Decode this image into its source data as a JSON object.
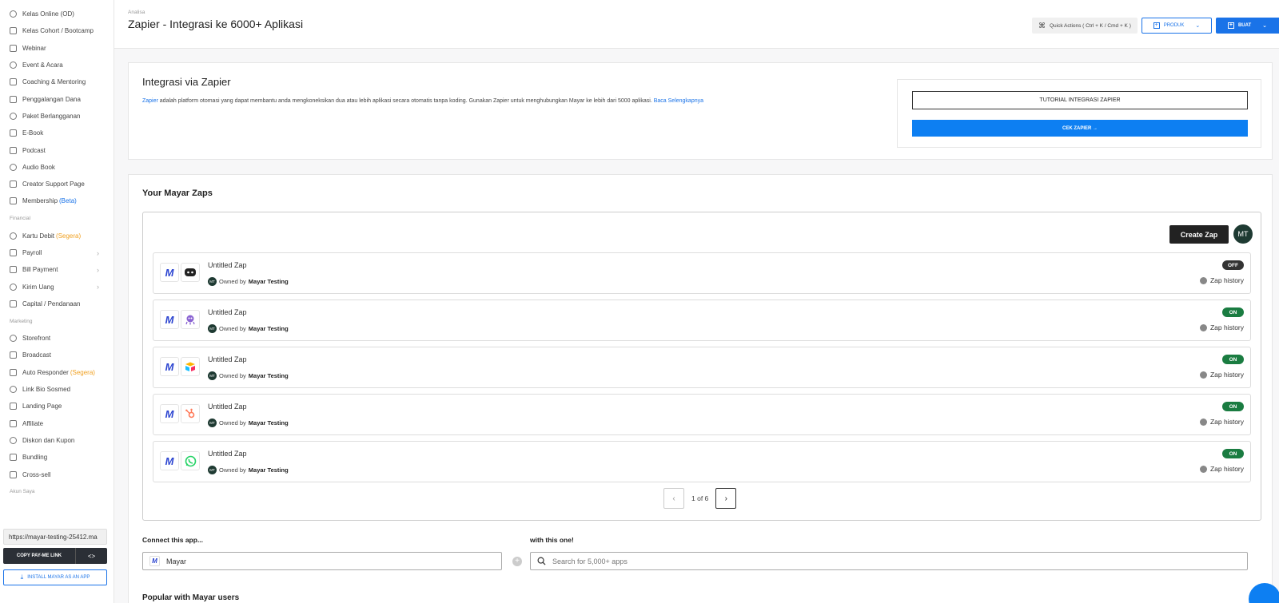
{
  "sidebar": {
    "items_top": [
      {
        "label": "Kelas Online (OD)",
        "icon": "grid-icon"
      },
      {
        "label": "Kelas Cohort / Bootcamp",
        "icon": "grid-icon"
      },
      {
        "label": "Webinar",
        "icon": "video-icon"
      },
      {
        "label": "Event & Acara",
        "icon": "event-icon"
      },
      {
        "label": "Coaching & Mentoring",
        "icon": "coach-icon"
      },
      {
        "label": "Penggalangan Dana",
        "icon": "heart-icon"
      },
      {
        "label": "Paket Berlangganan",
        "icon": "calendar-icon"
      },
      {
        "label": "E-Book",
        "icon": "book-icon"
      },
      {
        "label": "Podcast",
        "icon": "mic-icon"
      },
      {
        "label": "Audio Book",
        "icon": "headphones-icon"
      },
      {
        "label": "Creator Support Page",
        "icon": "smile-icon"
      },
      {
        "label": "Membership",
        "icon": "member-icon",
        "badge": "(Beta)"
      }
    ],
    "section_financial": "Financial",
    "items_financial": [
      {
        "label": "Kartu Debit",
        "badge": "(Segera)",
        "icon": "card-icon"
      },
      {
        "label": "Payroll",
        "icon": "payroll-icon",
        "chevron": true
      },
      {
        "label": "Bill Payment",
        "icon": "bill-icon",
        "chevron": true
      },
      {
        "label": "Kirim Uang",
        "icon": "send-icon",
        "chevron": true
      },
      {
        "label": "Capital / Pendanaan",
        "icon": "capital-icon"
      }
    ],
    "section_marketing": "Marketing",
    "items_marketing": [
      {
        "label": "Storefront",
        "icon": "store-icon"
      },
      {
        "label": "Broadcast",
        "icon": "rss-icon"
      },
      {
        "label": "Auto Responder",
        "badge": "(Segera)",
        "icon": "responder-icon"
      },
      {
        "label": "Link Bio Sosmed",
        "icon": "bookmark-icon"
      },
      {
        "label": "Landing Page",
        "icon": "monitor-icon"
      },
      {
        "label": "Affiliate",
        "icon": "affiliate-icon"
      },
      {
        "label": "Diskon dan Kupon",
        "icon": "percent-icon"
      },
      {
        "label": "Bundling",
        "icon": "box-icon"
      },
      {
        "label": "Cross-sell",
        "icon": "cross-sell-icon"
      }
    ],
    "section_account": "Akun Saya",
    "link_value": "https://mayar-testing-25412.ma",
    "copy_label": "COPY PAY-ME LINK",
    "code_label": "<>",
    "install_label": "INSTALL MAYAR AS AN APP"
  },
  "header": {
    "breadcrumb": "Analisa",
    "title": "Zapier - Integrasi ke 6000+ Aplikasi",
    "quick_actions": "Quick Actions ( Ctrl + K / Cmd + K )",
    "produk_label": "PRODUK",
    "buat_label": "BUAT"
  },
  "integration": {
    "title": "Integrasi via Zapier",
    "desc_link": "Zapier",
    "desc": " adalah platform otomasi yang dapat membantu anda mengkoneksikan dua atau lebih aplikasi secara otomatis tanpa koding. Gunakan Zapier untuk menghubungkan Mayar ke lebih dari 5000 aplikasi. ",
    "read_more": "Baca Selengkapnya",
    "tutorial_label": "TUTORIAL INTEGRASI ZAPIER",
    "cek_label": "CEK ZAPIER →"
  },
  "zaps": {
    "title": "Your Mayar Zaps",
    "create_label": "Create Zap",
    "avatar": "MT",
    "rows": [
      {
        "name": "Untitled Zap",
        "owned_prefix": "Owned by",
        "owner": "Mayar Testing",
        "status": "OFF",
        "app": "discord-icon",
        "history": "Zap history"
      },
      {
        "name": "Untitled Zap",
        "owned_prefix": "Owned by",
        "owner": "Mayar Testing",
        "status": "ON",
        "app": "octopus-icon",
        "history": "Zap history"
      },
      {
        "name": "Untitled Zap",
        "owned_prefix": "Owned by",
        "owner": "Mayar Testing",
        "status": "ON",
        "app": "airtable-icon",
        "history": "Zap history"
      },
      {
        "name": "Untitled Zap",
        "owned_prefix": "Owned by",
        "owner": "Mayar Testing",
        "status": "ON",
        "app": "hubspot-icon",
        "history": "Zap history"
      },
      {
        "name": "Untitled Zap",
        "owned_prefix": "Owned by",
        "owner": "Mayar Testing",
        "status": "ON",
        "app": "whatsapp-icon",
        "history": "Zap history"
      }
    ],
    "pager_text": "1 of 6"
  },
  "connect": {
    "label": "Connect this app...",
    "with_label": "with this one!",
    "app_value": "Mayar",
    "search_placeholder": "Search for 5,000+ apps",
    "popular": "Popular with Mayar users"
  },
  "colors": {
    "accent": "#1a73e8",
    "on": "#1a7c41",
    "off": "#333333",
    "mayar": "#2a43d0"
  }
}
